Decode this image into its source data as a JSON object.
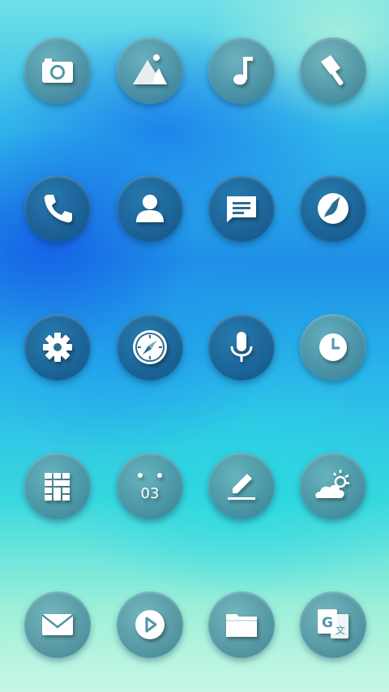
{
  "home_screen": {
    "apps": [
      {
        "icon": "camera-icon"
      },
      {
        "icon": "gallery-icon"
      },
      {
        "icon": "music-icon"
      },
      {
        "icon": "theme-paint-icon"
      },
      {
        "icon": "phone-icon"
      },
      {
        "icon": "contacts-icon"
      },
      {
        "icon": "messages-icon"
      },
      {
        "icon": "browser-icon"
      },
      {
        "icon": "settings-gear-icon"
      },
      {
        "icon": "compass-icon"
      },
      {
        "icon": "voice-recorder-icon"
      },
      {
        "icon": "clock-icon"
      },
      {
        "icon": "calculator-icon"
      },
      {
        "icon": "calendar-icon"
      },
      {
        "icon": "notes-icon"
      },
      {
        "icon": "weather-icon"
      },
      {
        "icon": "email-icon"
      },
      {
        "icon": "video-player-icon"
      },
      {
        "icon": "file-manager-icon"
      },
      {
        "icon": "translate-icon"
      }
    ],
    "calendar_day": "03",
    "translate_glyph_primary": "G",
    "translate_glyph_secondary": "文"
  }
}
